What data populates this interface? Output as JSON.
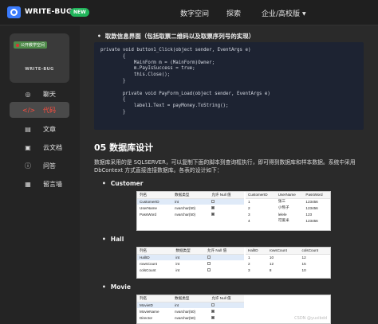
{
  "brand": {
    "name": "WRITE-BUG",
    "badge": "NEW"
  },
  "nav": [
    {
      "label": "数字空间"
    },
    {
      "label": "探索"
    },
    {
      "label": "企业/高校版"
    }
  ],
  "sidebar": {
    "card_tag": "公开教学空间",
    "card_name": "WRITE-BUG",
    "items": [
      {
        "label": "聊天",
        "icon": "chat-icon"
      },
      {
        "label": "代码",
        "icon": "code-icon"
      },
      {
        "label": "文章",
        "icon": "article-icon"
      },
      {
        "label": "云文档",
        "icon": "cloud-doc-icon"
      },
      {
        "label": "问答",
        "icon": "qa-icon"
      },
      {
        "label": "留言墙",
        "icon": "message-wall-icon"
      }
    ]
  },
  "content": {
    "bullet": "取款信息界面（包括取票二维码以及取票序列号的实现）",
    "code": [
      "private void button1_Click(object sender, EventArgs e)",
      "        {",
      "            MainForm m = (MainForm)Owner;",
      "            m.PayIsSuccess = true;",
      "            this.Close();",
      "        }",
      "",
      "        private void PayForm_Load(object sender, EventArgs e)",
      "        {",
      "            label1.Text = payMoney.ToString();",
      "        }"
    ],
    "section_title": "05 数据库设计",
    "para": "数据库采用的是 SQLSERVER，可以复制下面的脚本到查询框执行，即可得到数据库和样本数据。系统中采用 DbContext 方式直接连接数据库。各表的设计如下：",
    "tables": [
      {
        "name": "Customer"
      },
      {
        "name": "Hall"
      },
      {
        "name": "Movie"
      }
    ],
    "customer_schema": {
      "headers": [
        "列名",
        "数据类型",
        "允许 Null 值"
      ],
      "rows": [
        [
          "CustomerID",
          "int"
        ],
        [
          "UserName",
          "nvarchar(50)"
        ],
        [
          "PassWord",
          "nvarchar(50)"
        ]
      ]
    },
    "customer_data": {
      "headers": [
        "CustomerID",
        "UserName",
        "PassWord"
      ],
      "rows": [
        [
          "1",
          "张三",
          "123456"
        ],
        [
          "2",
          "小熊子",
          "123456"
        ],
        [
          "3",
          "lelele",
          "123"
        ],
        [
          "4",
          "可爱米",
          "123456"
        ]
      ]
    },
    "hall_schema": {
      "headers": [
        "列名",
        "数据类型",
        "允许 Null 值"
      ],
      "rows": [
        [
          "HallID",
          "int"
        ],
        [
          "rowsCount",
          "int"
        ],
        [
          "colsCount",
          "int"
        ]
      ]
    },
    "hall_data": {
      "headers": [
        "HallID",
        "rowsCount",
        "colsCount"
      ],
      "rows": [
        [
          "1",
          "10",
          "12"
        ],
        [
          "2",
          "12",
          "15"
        ],
        [
          "3",
          "8",
          "10"
        ]
      ]
    },
    "movie_schema": {
      "headers": [
        "列名",
        "数据类型",
        "允许 Null 值"
      ],
      "rows": [
        [
          "MovieID",
          "int"
        ],
        [
          "MovieName",
          "nvarchar(50)"
        ],
        [
          "Director",
          "nvarchar(50)"
        ]
      ]
    },
    "watermark": "CSDN @yuxibdd"
  }
}
